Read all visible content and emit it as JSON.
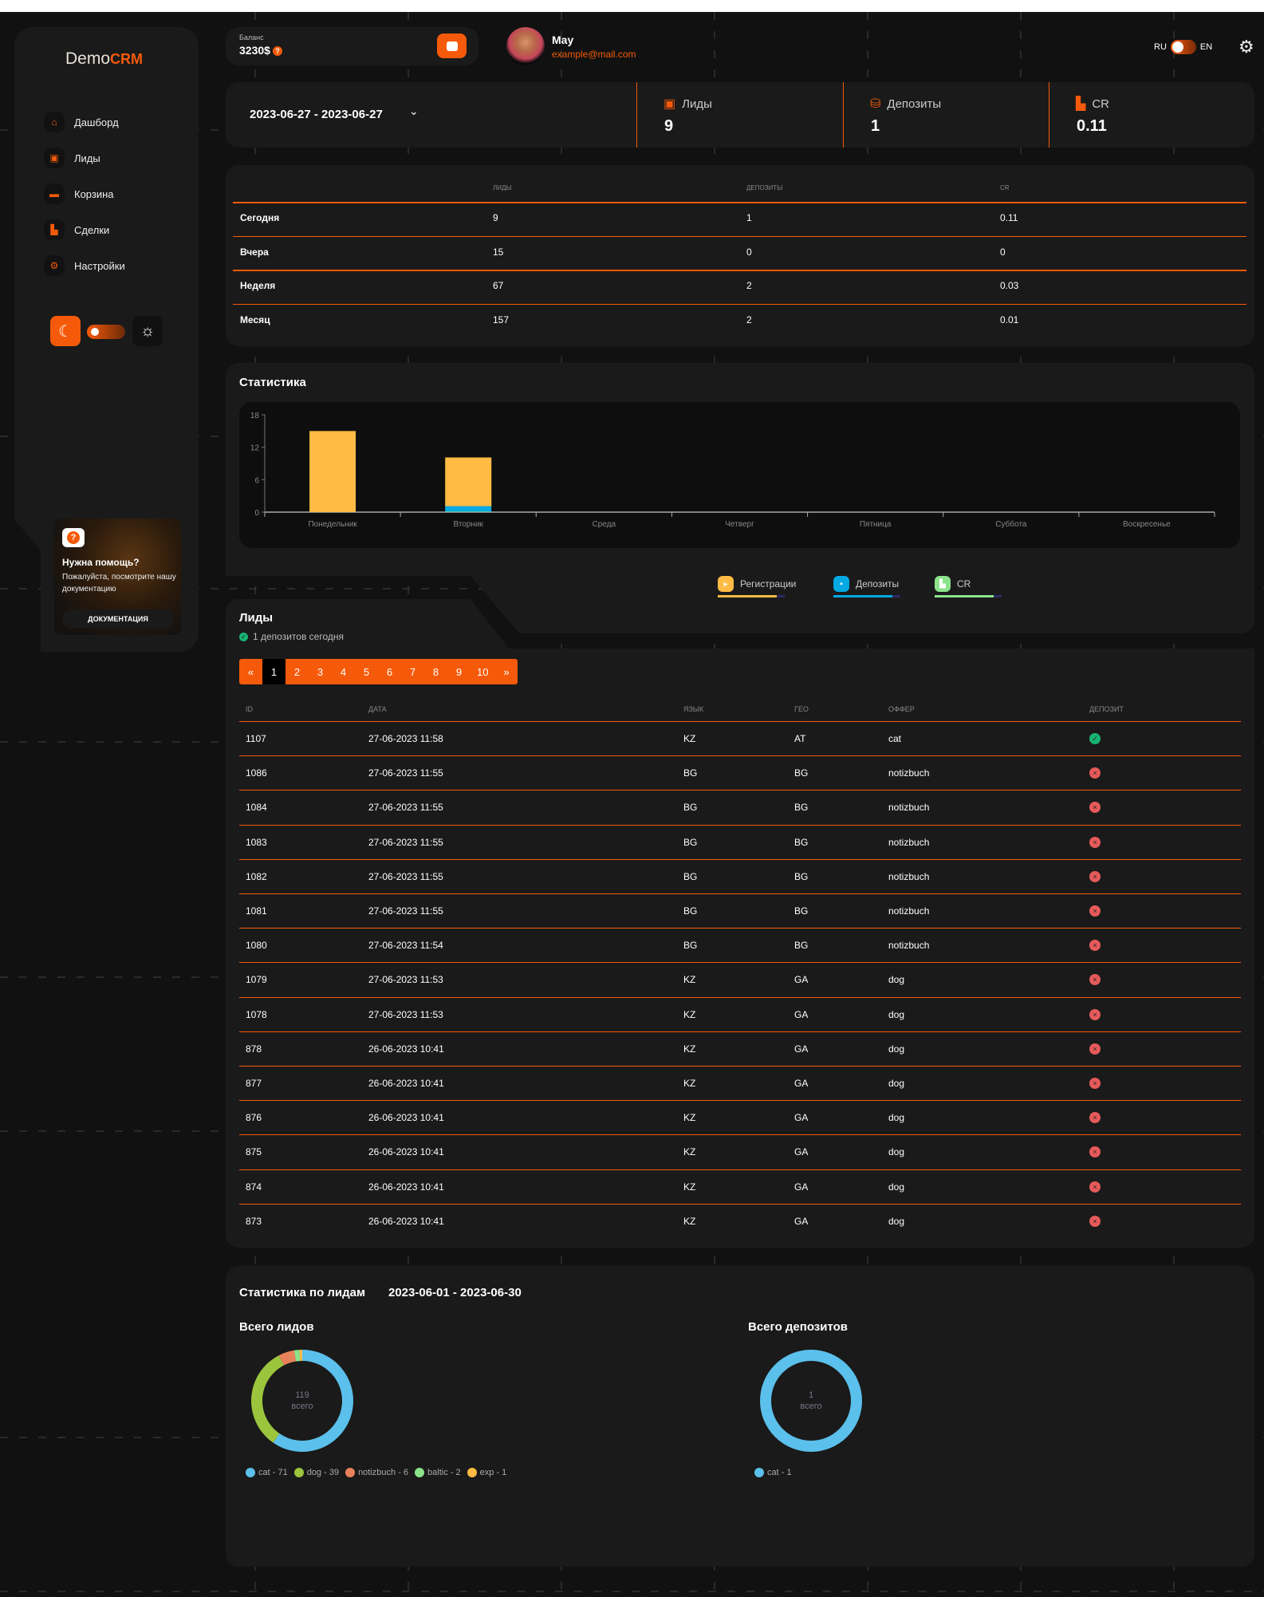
{
  "colors": {
    "accent": "#f55a0a",
    "registrations": "#ffbb44",
    "deposits": "#04a9e4",
    "cr": "#8be48b",
    "ok": "#16b472",
    "fail": "#e55a5a"
  },
  "sidebar": {
    "logo": {
      "part1": "Demo",
      "part2": "CRM"
    },
    "items": [
      {
        "label": "Дашборд",
        "icon": "home-icon"
      },
      {
        "label": "Лиды",
        "icon": "lead-file-icon"
      },
      {
        "label": "Корзина",
        "icon": "cart-card-icon"
      },
      {
        "label": "Сделки",
        "icon": "deals-icon"
      },
      {
        "label": "Настройки",
        "icon": "gear-icon"
      }
    ],
    "theme": {
      "mode": "dark"
    },
    "help": {
      "title": "Нужна помощь?",
      "text": "Пожалуйста, посмотрите нашу документацию",
      "button": "ДОКУМЕНТАЦИЯ"
    }
  },
  "header": {
    "balance_label": "Баланс",
    "balance_value": "3230$",
    "user_name": "May",
    "user_email": "example@mail.com",
    "lang_left": "RU",
    "lang_right": "EN"
  },
  "stats": {
    "date_range": "2023-06-27 - 2023-06-27",
    "items": [
      {
        "label": "Лиды",
        "value": "9"
      },
      {
        "label": "Депозиты",
        "value": "1"
      },
      {
        "label": "CR",
        "value": "0.11"
      }
    ]
  },
  "summary": {
    "headers": [
      "",
      "лиды",
      "депозиты",
      "cr"
    ],
    "rows": [
      [
        "Сегодня",
        "9",
        "1",
        "0.11"
      ],
      [
        "Вчера",
        "15",
        "0",
        "0"
      ],
      [
        "Неделя",
        "67",
        "2",
        "0.03"
      ],
      [
        "Месяц",
        "157",
        "2",
        "0.01"
      ]
    ]
  },
  "statistics": {
    "title": "Статистика",
    "legend": [
      "Регистрации",
      "Депозиты",
      "CR"
    ]
  },
  "chart_data": [
    {
      "type": "bar",
      "stacked": true,
      "categories": [
        "Понедельник",
        "Вторник",
        "Среда",
        "Четверг",
        "Пятница",
        "Суббота",
        "Воскресенье"
      ],
      "series": [
        {
          "name": "Регистрации",
          "values": [
            15,
            9,
            0,
            0,
            0,
            0,
            0
          ]
        },
        {
          "name": "Депозиты",
          "values": [
            0,
            1,
            0,
            0,
            0,
            0,
            0
          ]
        },
        {
          "name": "CR",
          "values": [
            0,
            0.11,
            0,
            0,
            0,
            0,
            0
          ]
        }
      ],
      "ylim": [
        0,
        18
      ],
      "yticks": [
        0,
        6,
        12,
        18
      ],
      "grid": false,
      "legend": "bottom"
    },
    {
      "type": "pie",
      "title": "Всего лидов",
      "center": [
        "119",
        "всего"
      ],
      "labels": [
        "cat",
        "dog",
        "notizbuch",
        "baltic",
        "exp"
      ],
      "values": [
        71,
        39,
        6,
        2,
        1
      ],
      "colors": [
        "#5bc0eb",
        "#9bc53d",
        "#e8825a",
        "#8be48b",
        "#ffbb44"
      ]
    },
    {
      "type": "pie",
      "title": "Всего депозитов",
      "center": [
        "1",
        "всего"
      ],
      "labels": [
        "cat"
      ],
      "values": [
        1
      ],
      "colors": [
        "#5bc0eb"
      ]
    }
  ],
  "leads": {
    "title": "Лиды",
    "subtitle": "1 депозитов сегодня",
    "pager": [
      "«",
      "1",
      "2",
      "3",
      "4",
      "5",
      "6",
      "7",
      "8",
      "9",
      "10",
      "»"
    ],
    "current_page": "1",
    "headers": [
      "ID",
      "ДАТА",
      "ЯЗЫК",
      "ГЕО",
      "ОФФЕР",
      "ДЕПОЗИТ"
    ],
    "rows": [
      [
        "1107",
        "27-06-2023 11:58",
        "KZ",
        "AT",
        "cat",
        true
      ],
      [
        "1086",
        "27-06-2023 11:55",
        "BG",
        "BG",
        "notizbuch",
        false
      ],
      [
        "1084",
        "27-06-2023 11:55",
        "BG",
        "BG",
        "notizbuch",
        false
      ],
      [
        "1083",
        "27-06-2023 11:55",
        "BG",
        "BG",
        "notizbuch",
        false
      ],
      [
        "1082",
        "27-06-2023 11:55",
        "BG",
        "BG",
        "notizbuch",
        false
      ],
      [
        "1081",
        "27-06-2023 11:55",
        "BG",
        "BG",
        "notizbuch",
        false
      ],
      [
        "1080",
        "27-06-2023 11:54",
        "BG",
        "BG",
        "notizbuch",
        false
      ],
      [
        "1079",
        "27-06-2023 11:53",
        "KZ",
        "GA",
        "dog",
        false
      ],
      [
        "1078",
        "27-06-2023 11:53",
        "KZ",
        "GA",
        "dog",
        false
      ],
      [
        "878",
        "26-06-2023 10:41",
        "KZ",
        "GA",
        "dog",
        false
      ],
      [
        "877",
        "26-06-2023 10:41",
        "KZ",
        "GA",
        "dog",
        false
      ],
      [
        "876",
        "26-06-2023 10:41",
        "KZ",
        "GA",
        "dog",
        false
      ],
      [
        "875",
        "26-06-2023 10:41",
        "KZ",
        "GA",
        "dog",
        false
      ],
      [
        "874",
        "26-06-2023 10:41",
        "KZ",
        "GA",
        "dog",
        false
      ],
      [
        "873",
        "26-06-2023 10:41",
        "KZ",
        "GA",
        "dog",
        false
      ]
    ]
  },
  "lead_stats": {
    "title": "Статистика по лидам",
    "date_range": "2023-06-01 - 2023-06-30"
  }
}
